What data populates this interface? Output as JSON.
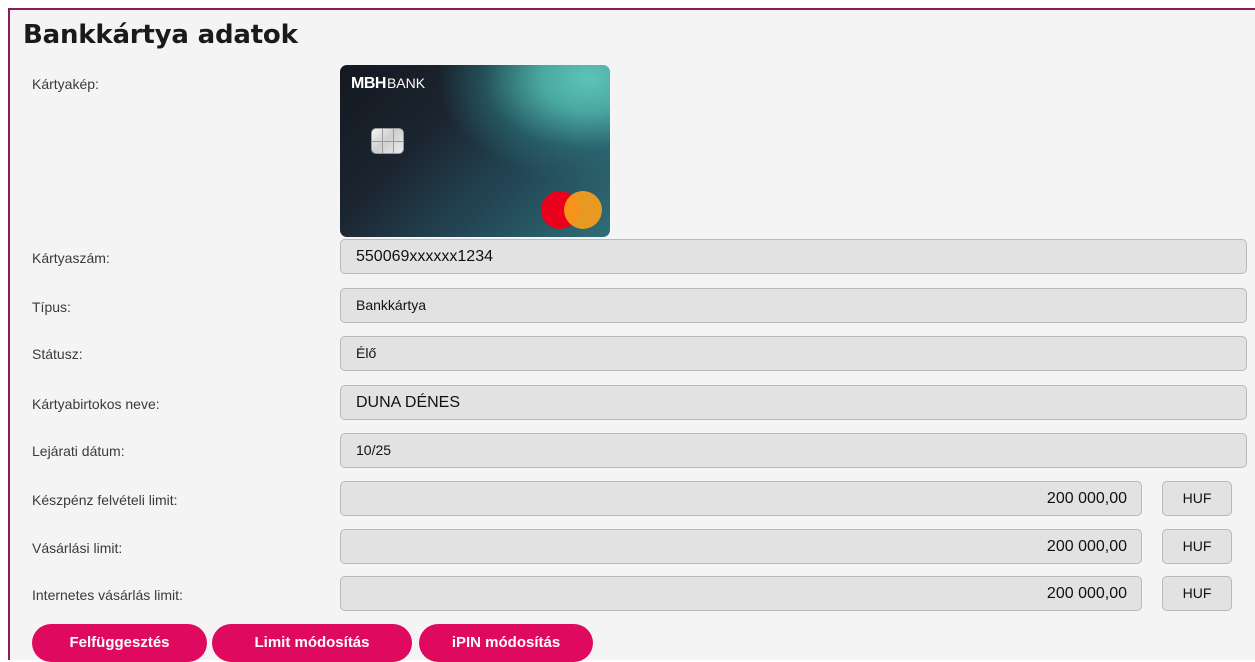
{
  "title": "Bankkártya adatok",
  "labels": {
    "card_image": "Kártyakép:",
    "card_number": "Kártyaszám:",
    "type": "Típus:",
    "status": "Státusz:",
    "holder_name": "Kártyabirtokos neve:",
    "expiry": "Lejárati dátum:",
    "cash_limit": "Készpénz felvételi limit:",
    "purchase_limit": "Vásárlási limit:",
    "internet_limit": "Internetes vásárlás limit:"
  },
  "values": {
    "card_number": "550069xxxxxx1234",
    "type": "Bankkártya",
    "status": "Élő",
    "holder_name": "DUNA DÉNES",
    "expiry": "10/25",
    "cash_limit": "200 000,00",
    "cash_currency": "HUF",
    "purchase_limit": "200 000,00",
    "purchase_currency": "HUF",
    "internet_limit": "200 000,00",
    "internet_currency": "HUF"
  },
  "card": {
    "brand_logo": "MBH",
    "brand_word": "BANK",
    "chip_icon": "chip-icon",
    "network_icon": "mastercard-logo"
  },
  "buttons": {
    "suspend": "Felfüggesztés",
    "limit_modify": "Limit módosítás",
    "ipin_modify": "iPIN módosítás"
  },
  "colors": {
    "accent": "#df0a5f",
    "frame": "#8a1b5e",
    "field_bg": "#e2e2e2"
  }
}
